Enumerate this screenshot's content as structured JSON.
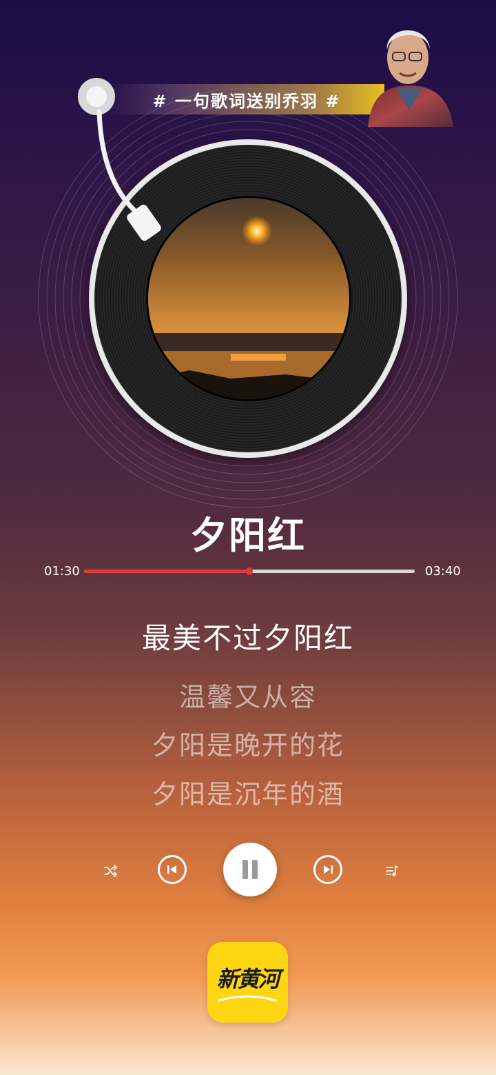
{
  "banner": {
    "text": "# 一句歌词送别乔羽 #"
  },
  "song": {
    "title": "夕阳红"
  },
  "player": {
    "elapsed": "01:30",
    "duration": "03:40",
    "progress": 0.5
  },
  "lyrics": {
    "current": "最美不过夕阳红",
    "next": [
      "温馨又从容",
      "夕阳是晚开的花",
      "夕阳是沉年的酒"
    ]
  },
  "controls": {
    "shuffle_icon": "shuffle-icon",
    "prev_icon": "skip-previous-icon",
    "pause_icon": "pause-icon",
    "next_icon": "skip-next-icon",
    "playlist_icon": "playlist-icon"
  },
  "brand": {
    "logo_text": "新黄河",
    "logo_color": "#fed512"
  },
  "colors": {
    "progress": "#e23a3a",
    "accent_banner": "#e8c020"
  }
}
